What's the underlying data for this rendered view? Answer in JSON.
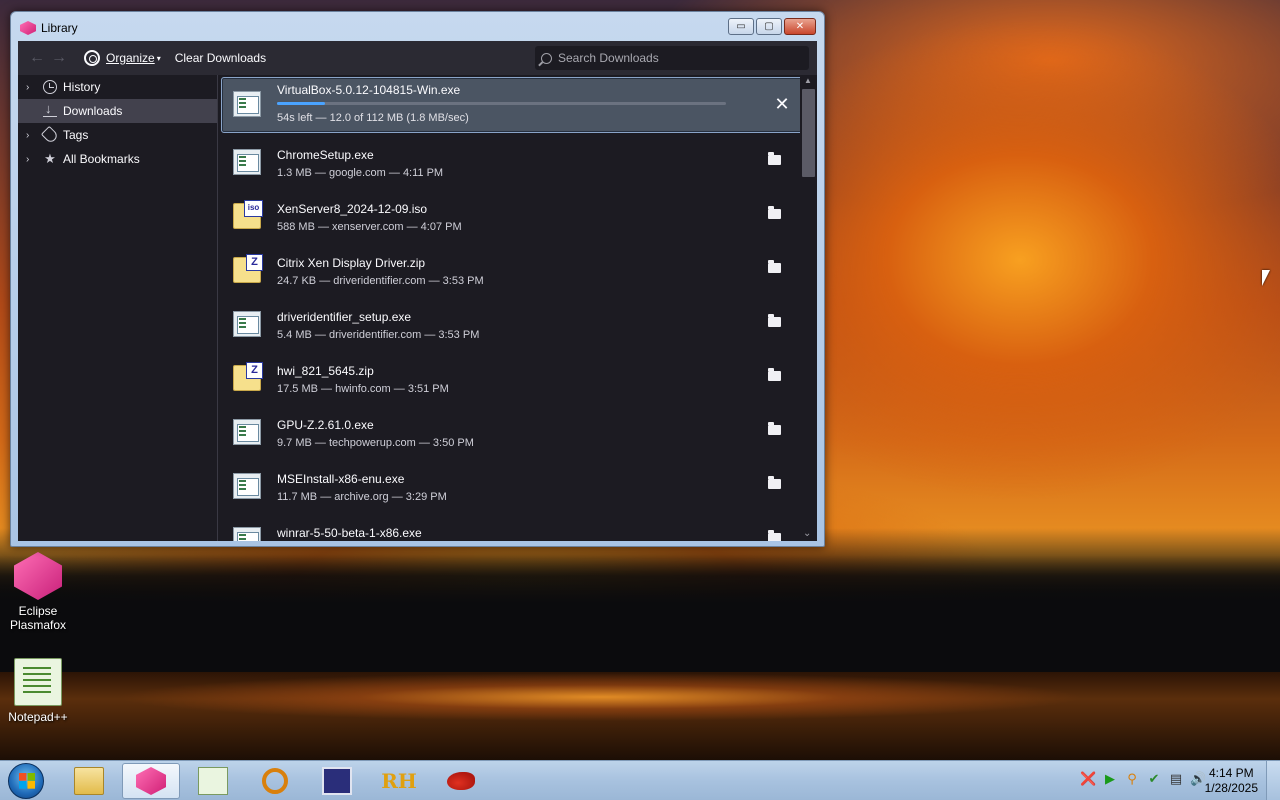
{
  "desktop": {
    "icons": [
      {
        "label_line1": "Eclipse",
        "label_line2": "Plasmafox"
      },
      {
        "label_line1": "Notepad++",
        "label_line2": ""
      }
    ]
  },
  "window": {
    "title": "Library",
    "caption_buttons": {
      "minimize": "▭",
      "maximize": "▢",
      "close": "✕"
    }
  },
  "toolbar": {
    "back_icon": "←",
    "forward_icon": "→",
    "organize_label": "Organize",
    "organize_caret": "▾",
    "clear_label": "Clear Downloads",
    "search_placeholder": "Search Downloads"
  },
  "sidebar": {
    "items": [
      {
        "label": "History",
        "twisty": "›",
        "icon": "clock-icon"
      },
      {
        "label": "Downloads",
        "twisty": "",
        "icon": "download-icon",
        "selected": true
      },
      {
        "label": "Tags",
        "twisty": "›",
        "icon": "tag-icon"
      },
      {
        "label": "All Bookmarks",
        "twisty": "›",
        "icon": "star-icon"
      }
    ]
  },
  "downloads": {
    "active": {
      "name": "VirtualBox-5.0.12-104815-Win.exe",
      "status": "54s left — 12.0 of 112 MB (1.8 MB/sec)",
      "progress_percent": 10.7,
      "cancel_icon": "✕"
    },
    "items": [
      {
        "name": "ChromeSetup.exe",
        "status": "1.3 MB — google.com — 4:11 PM",
        "type": "exe"
      },
      {
        "name": "XenServer8_2024-12-09.iso",
        "status": "588 MB — xenserver.com — 4:07 PM",
        "type": "iso",
        "badge": "iso"
      },
      {
        "name": "Citrix Xen Display Driver.zip",
        "status": "24.7 KB — driveridentifier.com — 3:53 PM",
        "type": "zip",
        "badge": "Z"
      },
      {
        "name": "driveridentifier_setup.exe",
        "status": "5.4 MB — driveridentifier.com — 3:53 PM",
        "type": "exe"
      },
      {
        "name": "hwi_821_5645.zip",
        "status": "17.5 MB — hwinfo.com — 3:51 PM",
        "type": "zip",
        "badge": "Z"
      },
      {
        "name": "GPU-Z.2.61.0.exe",
        "status": "9.7 MB — techpowerup.com — 3:50 PM",
        "type": "exe"
      },
      {
        "name": "MSEInstall-x86-enu.exe",
        "status": "11.7 MB — archive.org — 3:29 PM",
        "type": "exe"
      },
      {
        "name": "winrar-5-50-beta-1-x86.exe",
        "status": "",
        "type": "exe"
      }
    ]
  },
  "scrollbar": {
    "up": "▲",
    "down": "⌄"
  },
  "taskbar": {
    "rh_label": "RH",
    "tray_icons": [
      "❌",
      "▶",
      "⚲",
      "✔",
      "▤",
      "🔊"
    ],
    "time": "4:14 PM",
    "date": "1/28/2025"
  },
  "colors": {
    "accent": "#4aa3ff",
    "window_bg": "#1c1b22",
    "toolbar_bg": "#2b2a33",
    "selected_bg": "#42414d"
  }
}
